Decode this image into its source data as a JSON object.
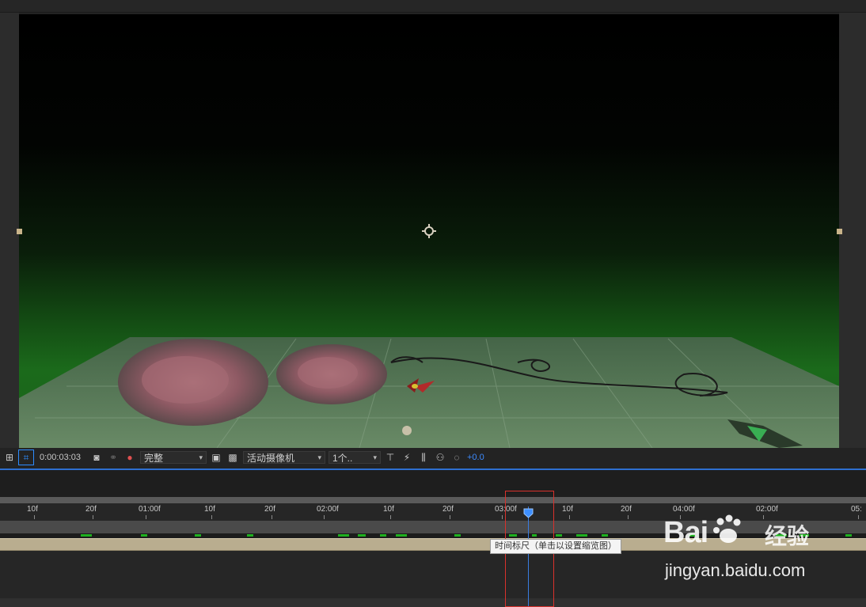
{
  "viewer": {
    "background_color": "#000000",
    "floor_tint": "#1a621a"
  },
  "toolbar": {
    "timecode": "0:00:03:03",
    "resolution": "完整",
    "camera": "活动摄像机",
    "views": "1个..",
    "exposure": "+0.0",
    "icons": [
      "region-of-interest-icon",
      "mask-toggle-icon",
      "snapshot-icon",
      "show-snapshot-icon",
      "color-channel-icon",
      "fast-preview-icon",
      "transparency-grid-icon",
      "3d-draft-icon",
      "flowchart-icon",
      "reset-exposure-icon"
    ]
  },
  "ruler": {
    "labels": [
      "10f",
      "20f",
      "01:00f",
      "10f",
      "20f",
      "02:00f",
      "10f",
      "20f",
      "03:00f",
      "10f",
      "20f",
      "04:00f",
      "02:00f",
      "05:"
    ]
  },
  "tooltip": {
    "text": "时间标尺（单击以设置缩览图）"
  },
  "watermark": {
    "brand": "Bai",
    "brand_suffix": "经验",
    "url": "jingyan.baidu.com"
  },
  "colors": {
    "accent_blue": "#2d8cff",
    "highlight_red": "#d9312c",
    "keyframe_green": "#1fb11f",
    "layer_bar": "#b9ad8f"
  }
}
